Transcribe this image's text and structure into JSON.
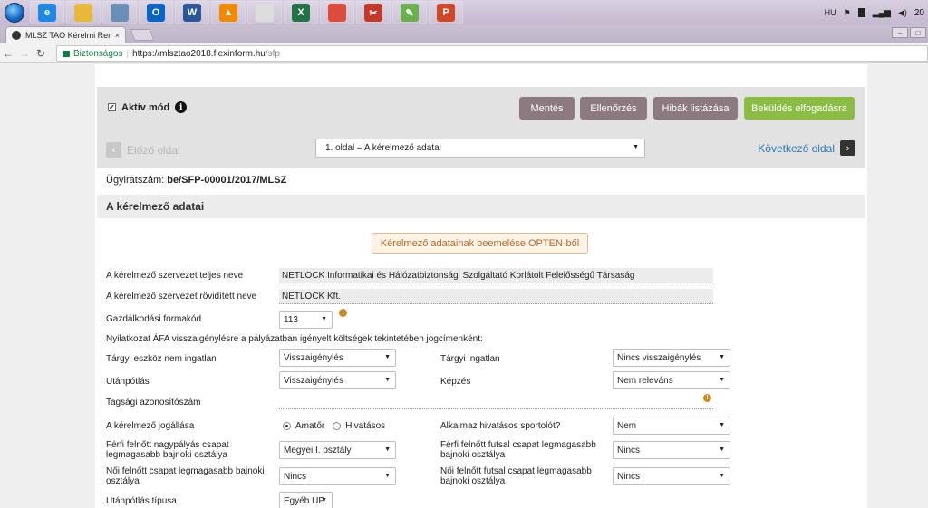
{
  "taskbar": {
    "apps": [
      {
        "name": "ie-icon",
        "label": "e",
        "color": "#1e88e5"
      },
      {
        "name": "folder-icon",
        "label": "",
        "color": "#e6b93c"
      },
      {
        "name": "calculator-icon",
        "label": "",
        "color": "#6a8fb5"
      },
      {
        "name": "outlook-icon",
        "label": "O",
        "color": "#0a64c6"
      },
      {
        "name": "word-icon",
        "label": "W",
        "color": "#2b579a"
      },
      {
        "name": "vlc-icon",
        "label": "▲",
        "color": "#f08a00"
      },
      {
        "name": "calendar-icon",
        "label": "",
        "color": "#dddddd"
      },
      {
        "name": "excel-icon",
        "label": "X",
        "color": "#217346"
      },
      {
        "name": "chrome-icon",
        "label": "",
        "color": "#dd4b39"
      },
      {
        "name": "snipping-icon",
        "label": "✂",
        "color": "#c0392b"
      },
      {
        "name": "pen-icon",
        "label": "✎",
        "color": "#6ab04c"
      },
      {
        "name": "powerpoint-icon",
        "label": "P",
        "color": "#d24726"
      }
    ],
    "language": "HU",
    "clock": "20"
  },
  "browser": {
    "tab_title": "MLSZ TAO Kérelmi Rend",
    "tab_close": "×",
    "secure_label": "Biztonságos",
    "url_host": "https://mlsztao2018.flexinform.hu",
    "url_path": "/sfp"
  },
  "toolbar": {
    "active_mode_label": "Aktív mód",
    "save_label": "Mentés",
    "check_label": "Ellenőrzés",
    "errors_label": "Hibák listázása",
    "submit_label": "Beküldés elfogadásra",
    "prev_label": "Előző oldal",
    "next_label": "Következő oldal",
    "page_select_value": "1. oldal – A kérelmező adatai"
  },
  "case": {
    "label": "Ügyiratszám:",
    "value": "be/SFP-00001/2017/MLSZ"
  },
  "section_title": "A kérelmező adatai",
  "import_button": "Kérelmező adatainak beemelése OPTEN-ből",
  "form": {
    "full_name_label": "A kérelmező szervezet teljes neve",
    "full_name_value": "NETLOCK Informatikai és Hálózatbiztonsági Szolgáltató Korlátolt Felelősségű Társaság",
    "short_name_label": "A kérelmező szervezet rövidített neve",
    "short_name_value": "NETLOCK Kft.",
    "form_code_label": "Gazdálkodási formakód",
    "form_code_value": "113",
    "vat_statement": "Nyilatkozat ÁFA visszaigénylésre a pályázatban igényelt költségek tekintetében jogcímenként:",
    "tangible_non_property_label": "Tárgyi eszköz nem ingatlan",
    "tangible_non_property_value": "Visszaigénylés",
    "tangible_property_label": "Tárgyi ingatlan",
    "tangible_property_value": "Nincs visszaigénylés",
    "youth_label": "Utánpótlás",
    "youth_value": "Visszaigénylés",
    "training_label": "Képzés",
    "training_value": "Nem releváns",
    "membership_label": "Tagsági azonosítószám",
    "legal_status_label": "A kérelmező jogállása",
    "amateur_label": "Amatőr",
    "professional_label": "Hivatásos",
    "pro_athletes_label": "Alkalmaz hivatásos sportolót?",
    "pro_athletes_value": "Nem",
    "men_big_label": "Férfi felnőtt nagypályás csapat legmagasabb bajnoki osztálya",
    "men_big_value": "Megyei I. osztály",
    "men_futsal_label": "Férfi felnőtt futsal csapat legmagasabb bajnoki osztálya",
    "men_futsal_value": "Nincs",
    "women_label": "Női felnőtt csapat legmagasabb bajnoki osztálya",
    "women_value": "Nincs",
    "women_futsal_label": "Női felnőtt futsal csapat legmagasabb bajnoki osztálya",
    "women_futsal_value": "Nincs",
    "youth_type_label": "Utánpótlás típusa",
    "youth_type_value": "Egyéb UP"
  },
  "colors": {
    "accent_green": "#8bbd45",
    "button_gray": "#8c7a80",
    "link_blue": "#337ab7",
    "warning_orange": "#d08a1c"
  }
}
